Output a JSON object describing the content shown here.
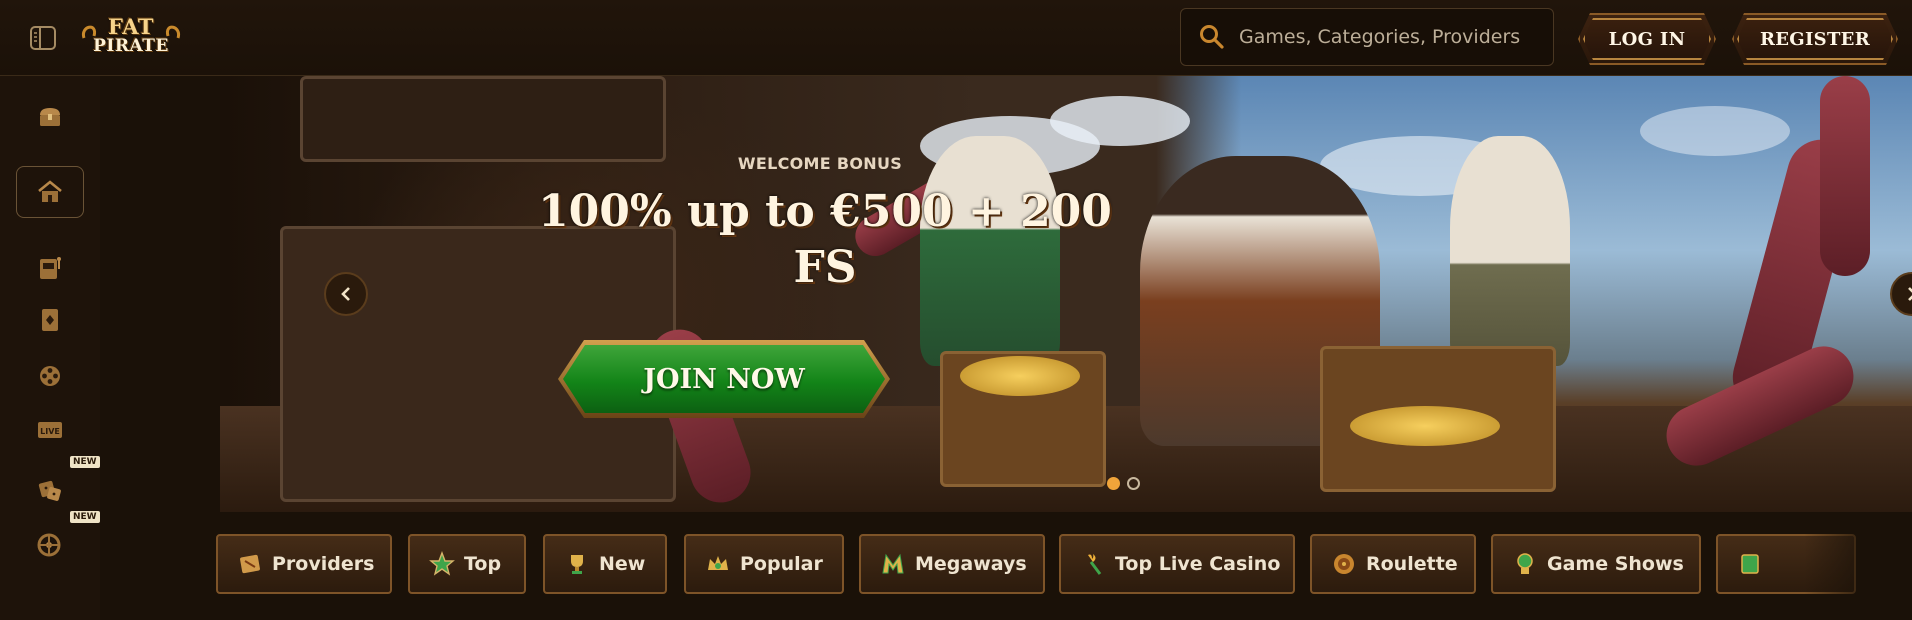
{
  "header": {
    "logo_line1": "FAT",
    "logo_line2": "PIRATE",
    "search_placeholder": "Games, Categories, Providers",
    "login_label": "LOG IN",
    "register_label": "REGISTER"
  },
  "sidebar": {
    "items": [
      {
        "icon": "treasure-chest-icon"
      },
      {
        "icon": "home-icon",
        "active": true
      },
      {
        "icon": "slot-machine-icon"
      },
      {
        "icon": "card-icon"
      },
      {
        "icon": "film-reel-icon"
      },
      {
        "icon": "live-icon",
        "text": "LIVE"
      },
      {
        "icon": "dice-icon",
        "badge": "NEW"
      },
      {
        "icon": "wheel-icon",
        "badge": "NEW"
      }
    ]
  },
  "banner": {
    "eyebrow": "WELCOME BONUS",
    "headline": "100% up to €500 + 200 FS",
    "cta": "JOIN NOW",
    "slides": 2,
    "active_slide": 1
  },
  "categories": [
    {
      "label": "Providers",
      "icon": "map-icon"
    },
    {
      "label": "Top",
      "icon": "star-icon"
    },
    {
      "label": "New",
      "icon": "trophy-icon"
    },
    {
      "label": "Popular",
      "icon": "crown-icon"
    },
    {
      "label": "Megaways",
      "icon": "megaways-icon"
    },
    {
      "label": "Top Live Casino",
      "icon": "torch-icon"
    },
    {
      "label": "Roulette",
      "icon": "roulette-icon"
    },
    {
      "label": "Game Shows",
      "icon": "globe-icon"
    },
    {
      "label": "",
      "icon": "book-icon"
    }
  ],
  "colors": {
    "accent_gold": "#b7853f",
    "cta_green": "#138418",
    "background": "#1c1209",
    "active_dot": "#f0a43a"
  }
}
